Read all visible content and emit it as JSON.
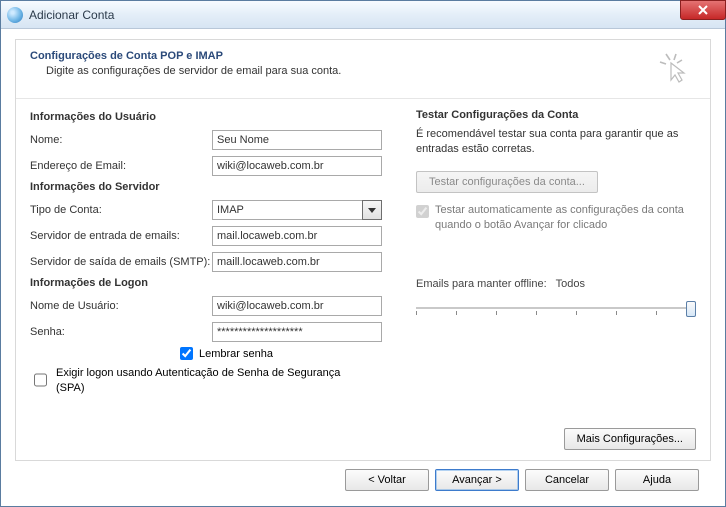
{
  "window": {
    "title": "Adicionar Conta"
  },
  "header": {
    "title": "Configurações de Conta POP e IMAP",
    "subtitle": "Digite as configurações de servidor de email para sua conta."
  },
  "sections": {
    "user": "Informações do Usuário",
    "server": "Informações do Servidor",
    "logon": "Informações de Logon"
  },
  "labels": {
    "name": "Nome:",
    "email": "Endereço de Email:",
    "accountType": "Tipo de Conta:",
    "incoming": "Servidor de entrada de emails:",
    "outgoing": "Servidor de saída de emails (SMTP):",
    "username": "Nome de Usuário:",
    "password": "Senha:",
    "remember": "Lembrar senha",
    "spa": "Exigir logon usando Autenticação de Senha de Segurança (SPA)"
  },
  "values": {
    "name": "Seu Nome",
    "email": "wiki@locaweb.com.br",
    "accountType": "IMAP",
    "incoming": "mail.locaweb.com.br",
    "outgoing": "maill.locaweb.com.br",
    "username": "wiki@locaweb.com.br",
    "password": "********************"
  },
  "right": {
    "title": "Testar Configurações da Conta",
    "text": "É recomendável testar sua conta para garantir que as entradas estão corretas.",
    "testButton": "Testar configurações da conta...",
    "autoTest": "Testar automaticamente as configurações da conta quando o botão Avançar for clicado",
    "sliderLabel": "Emails para manter offline:",
    "sliderValue": "Todos",
    "moreButton": "Mais Configurações..."
  },
  "footer": {
    "back": "< Voltar",
    "next": "Avançar >",
    "cancel": "Cancelar",
    "help": "Ajuda"
  }
}
